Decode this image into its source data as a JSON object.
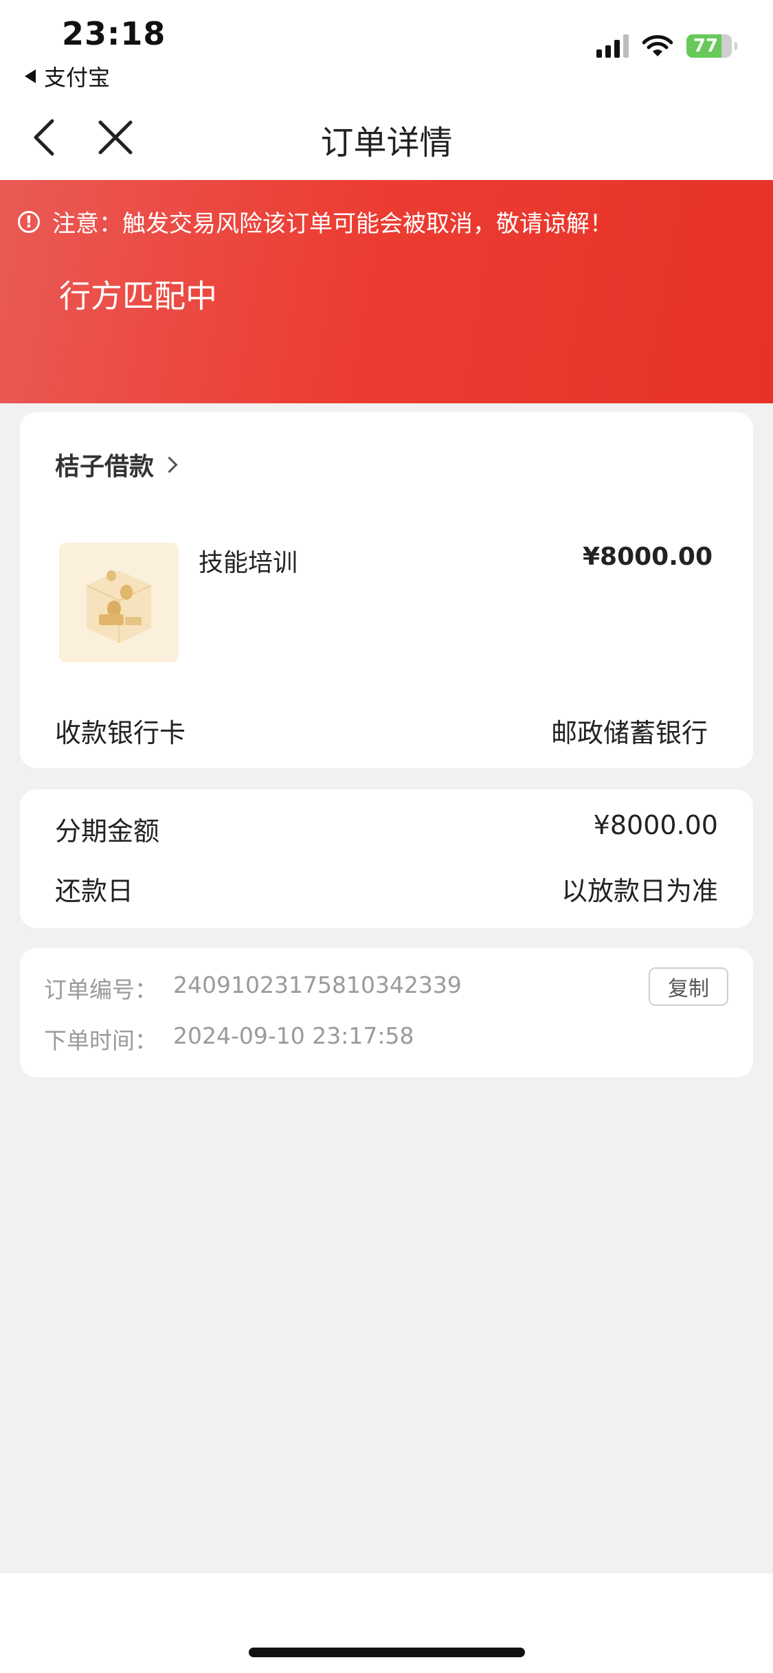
{
  "status_bar": {
    "time": "23:18",
    "back_app": "支付宝",
    "battery": "77",
    "battery_level": 0.77
  },
  "nav": {
    "title": "订单详情"
  },
  "banner": {
    "warning": "注意：触发交易风险该订单可能会被取消，敬请谅解！",
    "status": "行方匹配中"
  },
  "order": {
    "merchant": "桔子借款",
    "product_name": "技能培训",
    "product_price": "¥8000.00",
    "bank_label": "收款银行卡",
    "bank_value": "邮政储蓄银行"
  },
  "installment": {
    "amount_label": "分期金额",
    "amount_value": "¥8000.00",
    "repay_label": "还款日",
    "repay_value": "以放款日为准"
  },
  "info": {
    "order_no_label": "订单编号：",
    "order_no_value": "24091023175810342339",
    "copy_label": "复制",
    "time_label": "下单时间：",
    "time_value": "2024-09-10 23:17:58"
  }
}
